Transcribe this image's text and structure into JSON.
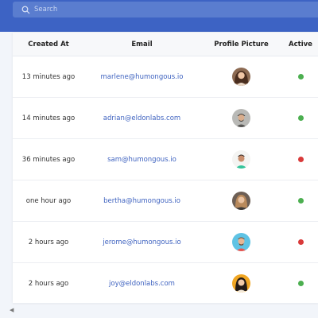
{
  "search": {
    "placeholder": "Search",
    "icon": "search-icon"
  },
  "table": {
    "columns": [
      "Created At",
      "Email",
      "Profile Picture",
      "Active"
    ],
    "rows": [
      {
        "created_at": "13 minutes ago",
        "email": "marlene@humongous.io",
        "active": true
      },
      {
        "created_at": "14 minutes ago",
        "email": "adrian@eldonlabs.com",
        "active": true
      },
      {
        "created_at": "36 minutes ago",
        "email": "sam@humongous.io",
        "active": false
      },
      {
        "created_at": "one hour ago",
        "email": "bertha@humongous.io",
        "active": true
      },
      {
        "created_at": "2 hours ago",
        "email": "jerome@humongous.io",
        "active": false
      },
      {
        "created_at": "2 hours ago",
        "email": "joy@eldonlabs.com",
        "active": true
      }
    ]
  },
  "colors": {
    "header_bar": "#3d63c4",
    "link": "#3f63c0",
    "active": "#4caf50",
    "inactive": "#d93a3a"
  }
}
